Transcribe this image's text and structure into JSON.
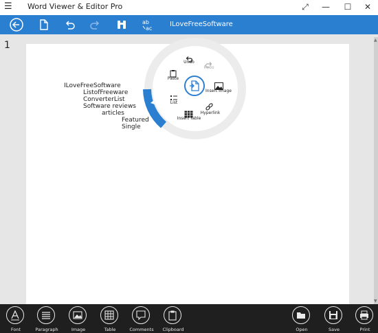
{
  "app": {
    "title": "Word Viewer & Editor Pro"
  },
  "window_controls": {
    "resize": "⤢",
    "minimize": "—",
    "maximize": "☐",
    "close": "✕"
  },
  "toolbar": {
    "buttons": [
      {
        "name": "back",
        "icon": "back-arrow-icon"
      },
      {
        "name": "new",
        "icon": "document-icon"
      },
      {
        "name": "undo",
        "icon": "undo-icon"
      },
      {
        "name": "redo",
        "icon": "redo-icon"
      },
      {
        "name": "find",
        "icon": "binoculars-icon"
      },
      {
        "name": "replace",
        "icon": "replace-icon"
      }
    ],
    "document_name": "ILoveFreeSoftware",
    "accent": "#2b7fd1"
  },
  "page": {
    "number": "1"
  },
  "document": {
    "lines": [
      "ILoveFreeSoftware",
      "ListofFreeware",
      "ConverterList",
      "Software  reviews",
      "articles",
      "Featured",
      "Single"
    ]
  },
  "radial_menu": {
    "items": {
      "undo": "Undo",
      "redo": "Redo",
      "paste": "Paste",
      "insert_image": "Insert Image",
      "list": "List",
      "hyperlink": "Hyperlink",
      "insert_table": "Insert Table"
    }
  },
  "bottom_bar": {
    "left": [
      "Font",
      "Paragraph",
      "Image",
      "Table",
      "Comments",
      "Clipboard"
    ],
    "right": [
      "Open",
      "Save",
      "Print"
    ]
  }
}
